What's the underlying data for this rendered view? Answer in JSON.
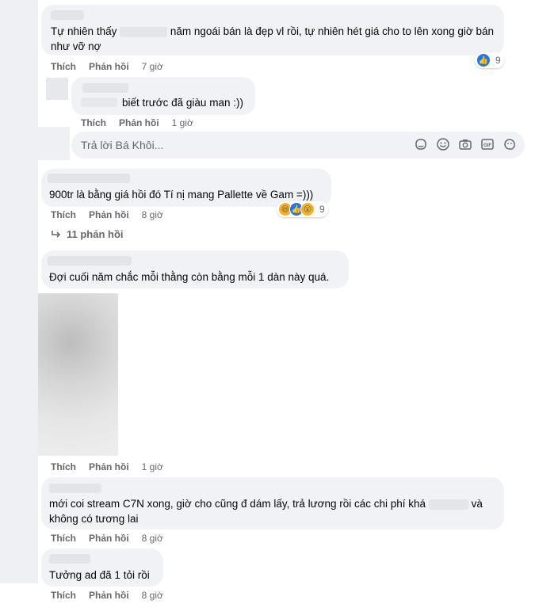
{
  "comments": [
    {
      "text_before": "Tự nhiên thấy",
      "text_after": "năm ngoái bán là đẹp vl rồi, tự nhiên hét giá cho to lên xong giờ bán như vỡ nợ",
      "like_label": "Thích",
      "reply_label": "Phản hồi",
      "time": "7 giờ",
      "reaction_count": "9",
      "reaction_icons": [
        "like-icon"
      ]
    },
    {
      "text": "biết trước đã giàu man :))",
      "like_label": "Thích",
      "reply_label": "Phản hồi",
      "time": "1 giờ"
    },
    {
      "text": "900tr là bằng giá hồi đó Tí nị mang Pallette về Gam =)))",
      "like_label": "Thích",
      "reply_label": "Phản hồi",
      "time": "8 giờ",
      "reaction_count": "9",
      "reaction_icons": [
        "haha-icon",
        "like-icon",
        "wow-icon"
      ],
      "replies_link": "11 phản hồi"
    },
    {
      "text": "Đợi cuối năm chắc mỗi thằng còn bằng mỗi 1 dàn này quá.",
      "like_label": "Thích",
      "reply_label": "Phản hồi",
      "time": "1 giờ"
    },
    {
      "text_before": "mới coi stream C7N xong, giờ cho cũng đ dám lấy, trả lương rồi các chi phí khá",
      "text_after": "và không có tương lai",
      "like_label": "Thích",
      "reply_label": "Phản hồi",
      "time": "8 giờ"
    },
    {
      "text": "Tưởng ad đã 1 tỏi rồi",
      "like_label": "Thích",
      "reply_label": "Phản hồi",
      "time": "8 giờ"
    }
  ],
  "reply_box": {
    "placeholder": "Trả lời Bá Khôi...",
    "icons": [
      "sticker-icon",
      "emoji-icon",
      "camera-icon",
      "gif-icon",
      "avatar-sticker-icon"
    ]
  },
  "colors": {
    "bubble": "#f0f2f5",
    "secondary_text": "#65676b",
    "like_blue": "#1877f2"
  }
}
